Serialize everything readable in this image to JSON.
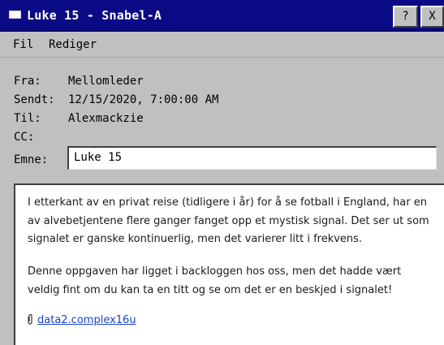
{
  "window": {
    "title": "Luke 15 - Snabel-A",
    "help_button": "?",
    "close_button": "X"
  },
  "menu": {
    "items": [
      "Fil",
      "Rediger"
    ]
  },
  "email": {
    "from_label": "Fra:",
    "from": "Mellomleder",
    "sent_label": "Sendt:",
    "sent": "12/15/2020, 7:00:00 AM",
    "to_label": "Til:",
    "to": "Alexmackzie",
    "cc_label": "CC:",
    "subject_label": "Emne:",
    "subject": "Luke 15",
    "body": [
      "I etterkant av en privat reise (tidligere i år) for å se fotball i England, har en av alvebetjentene flere ganger fanget opp et mystisk signal. Det ser ut som signalet er ganske kontinuerlig, men det varierer litt i frekvens.",
      "Denne oppgaven har ligget i backloggen hos oss, men det hadde vært veldig fint om du kan ta en titt og se om det er en beskjed i signalet!"
    ],
    "attachment": "data2.complex16u"
  },
  "icons": {
    "window_icon": "mail-window-icon",
    "attachment_icon": "paperclip-icon"
  }
}
